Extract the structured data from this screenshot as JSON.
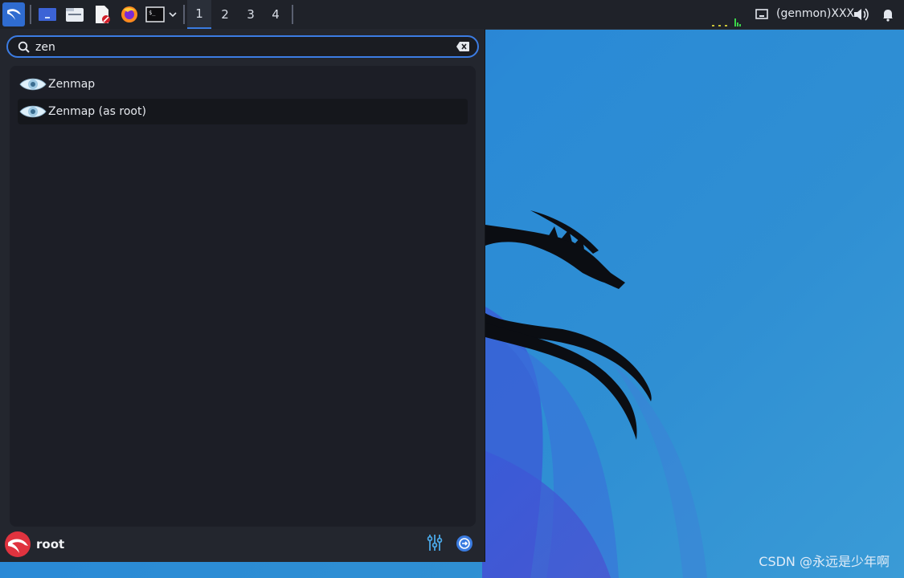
{
  "taskbar": {
    "launchers": [
      "kali-menu-icon",
      "show-desktop-icon",
      "file-manager-icon",
      "text-editor-icon",
      "firefox-icon",
      "terminal-icon"
    ],
    "workspaces": [
      "1",
      "2",
      "3",
      "4"
    ],
    "active_workspace": "1",
    "genmon_label": "(genmon)XXX"
  },
  "menu": {
    "search_value": "zen",
    "results": [
      {
        "label": "Zenmap",
        "icon": "zenmap-eye-icon"
      },
      {
        "label": "Zenmap (as root)",
        "icon": "zenmap-eye-icon"
      }
    ],
    "selected_index": 1,
    "user": "root"
  },
  "watermark": "CSDN @永远是少年啊",
  "colors": {
    "accent": "#3c7ce3",
    "panel": "#1f2229",
    "menu_bg": "#23262e"
  }
}
